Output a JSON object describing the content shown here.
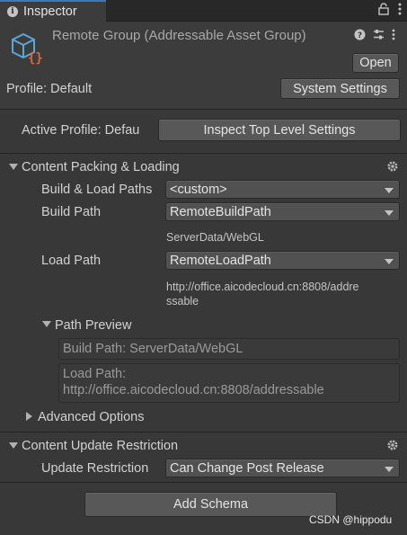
{
  "tab": {
    "title": "Inspector"
  },
  "header": {
    "title": "Remote Group (Addressable Asset Group)",
    "open_button": "Open"
  },
  "profile": {
    "label": "Profile: Default",
    "system_settings_button": "System Settings"
  },
  "active_profile": {
    "label": "Active Profile: Defau",
    "inspect_button": "Inspect Top Level Settings"
  },
  "content_packing": {
    "title": "Content Packing & Loading",
    "build_load_paths_label": "Build & Load Paths",
    "build_load_paths_value": "<custom>",
    "build_path_label": "Build Path",
    "build_path_value": "RemoteBuildPath",
    "build_path_resolved": "ServerData/WebGL",
    "load_path_label": "Load Path",
    "load_path_value": "RemoteLoadPath",
    "load_path_resolved_line1": "http://office.aicodecloud.cn:8808/addre",
    "load_path_resolved_line2": "ssable",
    "path_preview_title": "Path Preview",
    "preview_build": "Build Path: ServerData/WebGL",
    "preview_load_line1": "Load Path:",
    "preview_load_line2": "http://office.aicodecloud.cn:8808/addressable",
    "advanced_options": "Advanced Options"
  },
  "content_update": {
    "title": "Content Update Restriction",
    "update_restriction_label": "Update Restriction",
    "update_restriction_value": "Can Change Post Release"
  },
  "add_schema_button": "Add Schema",
  "watermark": "CSDN @hippodu",
  "colors": {
    "background": "#383838",
    "header": "#3c3c3c",
    "tab_accent": "#3a79bb",
    "icon_orange": "#e0663a",
    "icon_blue": "#5aa7d8"
  }
}
